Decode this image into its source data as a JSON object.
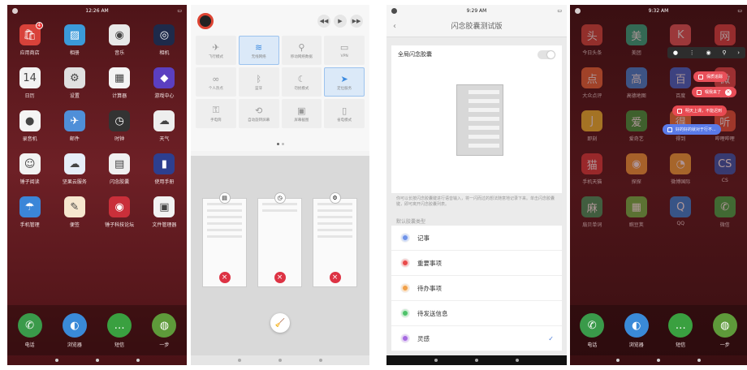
{
  "panel1": {
    "status": {
      "time": "12:26 AM"
    },
    "apps": [
      {
        "label": "应用商店",
        "icon": "store-icon",
        "bg": "#d8423a",
        "glyph": "🛍",
        "badge": "4"
      },
      {
        "label": "相册",
        "icon": "gallery-icon",
        "bg": "#3b9ad9",
        "glyph": "▨"
      },
      {
        "label": "音乐",
        "icon": "music-icon",
        "bg": "#e8e8e8",
        "glyph": "◉"
      },
      {
        "label": "相机",
        "icon": "camera-icon",
        "bg": "#1e2a4a",
        "glyph": "◎"
      },
      {
        "label": "日历",
        "icon": "calendar-icon",
        "bg": "#f2f2f2",
        "glyph": "14"
      },
      {
        "label": "设置",
        "icon": "settings-icon",
        "bg": "#e0e0e0",
        "glyph": "⚙"
      },
      {
        "label": "计算器",
        "icon": "calculator-icon",
        "bg": "#f4f4f4",
        "glyph": "▦"
      },
      {
        "label": "游戏中心",
        "icon": "game-center-icon",
        "bg": "#5b3fc0",
        "glyph": "◆"
      },
      {
        "label": "录音机",
        "icon": "recorder-icon",
        "bg": "#f4f4f4",
        "glyph": "●"
      },
      {
        "label": "邮件",
        "icon": "mail-icon",
        "bg": "#4f8fd8",
        "glyph": "✈"
      },
      {
        "label": "时钟",
        "icon": "clock-icon",
        "bg": "#333333",
        "glyph": "◷"
      },
      {
        "label": "天气",
        "icon": "weather-icon",
        "bg": "#eeeeee",
        "glyph": "☁"
      },
      {
        "label": "锤子阅读",
        "icon": "reader-icon",
        "bg": "#f2f2f2",
        "glyph": "☺"
      },
      {
        "label": "坚果云服务",
        "icon": "cloud-icon",
        "bg": "#e6eef8",
        "glyph": "☁"
      },
      {
        "label": "闪念胶囊",
        "icon": "capsule-icon",
        "bg": "#f0f0f0",
        "glyph": "▤"
      },
      {
        "label": "使用手册",
        "icon": "manual-icon",
        "bg": "#2d3f8f",
        "glyph": "▮"
      },
      {
        "label": "手机管理",
        "icon": "phone-manager-icon",
        "bg": "#3b86d8",
        "glyph": "☂"
      },
      {
        "label": "便签",
        "icon": "notes-icon",
        "bg": "#f6e7cf",
        "glyph": "✎"
      },
      {
        "label": "锤子科技论坛",
        "icon": "forum-icon",
        "bg": "#c92f3a",
        "glyph": "◉"
      },
      {
        "label": "文件管理器",
        "icon": "file-manager-icon",
        "bg": "#f2f2f2",
        "glyph": "▣"
      }
    ],
    "dock": [
      {
        "label": "电话",
        "icon": "phone-icon",
        "bg": "#3a9a4a",
        "glyph": "✆"
      },
      {
        "label": "浏览器",
        "icon": "browser-icon",
        "bg": "#3a8ad8",
        "glyph": "◐"
      },
      {
        "label": "短信",
        "icon": "messages-icon",
        "bg": "#3aa040",
        "glyph": "…"
      },
      {
        "label": "一步",
        "icon": "one-step-icon",
        "bg": "#5e9a3a",
        "glyph": "◍"
      }
    ]
  },
  "panel2": {
    "tiles": [
      {
        "label": "飞行模式",
        "icon": "airplane-icon",
        "glyph": "✈",
        "on": false
      },
      {
        "label": "无线网络",
        "icon": "wifi-icon",
        "glyph": "≋",
        "on": true
      },
      {
        "label": "移动网络数据",
        "icon": "mobile-data-icon",
        "glyph": "⚲",
        "on": false
      },
      {
        "label": "VPN",
        "icon": "vpn-icon",
        "glyph": "▭",
        "on": false
      },
      {
        "label": "个人热点",
        "icon": "hotspot-icon",
        "glyph": "∞",
        "on": false
      },
      {
        "label": "蓝牙",
        "icon": "bluetooth-icon",
        "glyph": "ᛒ",
        "on": false
      },
      {
        "label": "勿扰模式",
        "icon": "do-not-disturb-icon",
        "glyph": "☾",
        "on": false
      },
      {
        "label": "定位服务",
        "icon": "location-icon",
        "glyph": "➤",
        "on": true
      },
      {
        "label": "手电筒",
        "icon": "flashlight-icon",
        "glyph": "⚿",
        "on": false
      },
      {
        "label": "自动旋转屏幕",
        "icon": "rotate-icon",
        "glyph": "⟲",
        "on": false
      },
      {
        "label": "屏幕截图",
        "icon": "screenshot-icon",
        "glyph": "▣",
        "on": false
      },
      {
        "label": "省电模式",
        "icon": "battery-icon",
        "glyph": "▯",
        "on": false
      }
    ]
  },
  "panel3": {
    "status": {
      "time": "9:29 AM"
    },
    "title": "闪念胶囊测试版",
    "toggle_label": "全局闪念胶囊",
    "description": "你可以长按闪念胶囊键进行语音输入，将一闪而过的想法随意地记录下来。单击闪念胶囊键，即可离开闪念胶囊列表。",
    "section_label": "默认胶囊类型",
    "types": [
      {
        "label": "记事",
        "color": "#6f93e8",
        "checked": false
      },
      {
        "label": "重要事项",
        "color": "#e84a4a",
        "checked": false
      },
      {
        "label": "待办事项",
        "color": "#f0a04a",
        "checked": false
      },
      {
        "label": "待发送信息",
        "color": "#4ec26a",
        "checked": false
      },
      {
        "label": "灵感",
        "color": "#a56ae0",
        "checked": true
      }
    ]
  },
  "panel4": {
    "status": {
      "time": "9:32 AM"
    },
    "apps": [
      {
        "label": "今日头条",
        "bg": "#d94a40",
        "glyph": "头"
      },
      {
        "label": "美团",
        "bg": "#2db38a",
        "glyph": "美"
      },
      {
        "label": "全民K歌",
        "bg": "#e85a5a",
        "glyph": "K"
      },
      {
        "label": "网易云",
        "bg": "#e04444",
        "glyph": "网"
      },
      {
        "label": "大众点评",
        "bg": "#ee6a3a",
        "glyph": "点"
      },
      {
        "label": "高德地图",
        "bg": "#3a8ae0",
        "glyph": "高"
      },
      {
        "label": "百度",
        "bg": "#3a6ad8",
        "glyph": "百"
      },
      {
        "label": "微博",
        "bg": "#e84a4a",
        "glyph": "微"
      },
      {
        "label": "即刻",
        "bg": "#f2c230",
        "glyph": "J"
      },
      {
        "label": "爱奇艺",
        "bg": "#3aa040",
        "glyph": "爱"
      },
      {
        "label": "得到",
        "bg": "#f07a3a",
        "glyph": "得"
      },
      {
        "label": "哔哩哔哩",
        "bg": "#e8563a",
        "glyph": "听"
      },
      {
        "label": "手机天猫",
        "bg": "#d93a3a",
        "glyph": "猫"
      },
      {
        "label": "探探",
        "bg": "#f3a03a",
        "glyph": "◉"
      },
      {
        "label": "微博国际",
        "bg": "#f2a83a",
        "glyph": "◔"
      },
      {
        "label": "CS",
        "bg": "#2a5ab8",
        "glyph": "CS"
      },
      {
        "label": "扇贝单词",
        "bg": "#3a9a60",
        "glyph": "麻"
      },
      {
        "label": "豌豆荚",
        "bg": "#6ac04a",
        "glyph": "▦"
      },
      {
        "label": "QQ",
        "bg": "#2a8ae0",
        "glyph": "Q"
      },
      {
        "label": "微信",
        "bg": "#3ab04a",
        "glyph": "✆"
      }
    ],
    "bubbles": [
      {
        "text": "保质追踪",
        "color": "#e8505a"
      },
      {
        "text": "嘱我来了",
        "color": "#e84e58"
      },
      {
        "text": "明天上课，不能迟到",
        "color": "#e84a52"
      },
      {
        "text": "好的好的就对于行不...",
        "color": "#5a7ae8"
      }
    ]
  }
}
